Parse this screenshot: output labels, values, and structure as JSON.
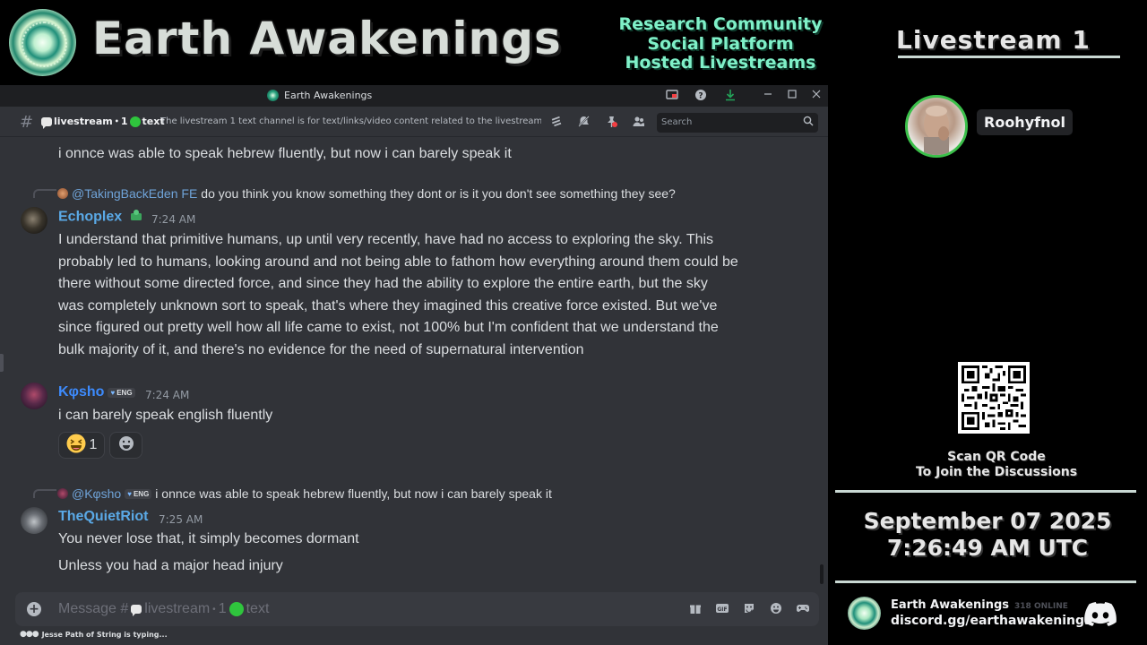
{
  "banner": {
    "title": "Earth Awakenings",
    "taglines": [
      "Research Community",
      "Social Platform",
      "Hosted Livestreams"
    ]
  },
  "window": {
    "app_title": "Earth Awakenings",
    "channel": {
      "name_prefix": "livestream",
      "name_separator": "•",
      "name_number": "1",
      "name_suffix": "text",
      "topic": "The livestream 1 text channel is for text/links/video content related to the livestream 1 voice ..."
    },
    "search_placeholder": "Search"
  },
  "messages": {
    "partial_top_text": "i onnce was able to speak hebrew fluently, but now i can barely speak it",
    "m1": {
      "reply_mention": "@TakingBackEden FE",
      "reply_text": "do you think you know something they dont or is it you don't see something they see?",
      "username": "Echoplex",
      "username_color": "#5aa9e6",
      "timestamp": "7:24 AM",
      "lines": [
        "I understand that primitive humans, up until very recently, have had no access to exploring the sky. This",
        "probably led to humans, looking around and not being able to fathom how everything around them could be",
        "there without some directed force, and since they had the ability to explore the entire earth, but the sky",
        "was completely unknown sort to speak, that's where they imagined this creative force existed. But we've",
        "since figured out pretty well how all life came to exist, not 100% but I'm confident that we understand the",
        "bulk majority of it, and there's no evidence for the need of supernatural intervention"
      ]
    },
    "m2": {
      "username": "Kφsho",
      "username_color": "#3d8bfd",
      "badge": "ENG",
      "timestamp": "7:24 AM",
      "text": "i can barely speak english fluently",
      "reaction_count": "1"
    },
    "m3": {
      "reply_mention": "@Kφsho",
      "reply_badge": "ENG",
      "reply_text": "i onnce was able to speak hebrew fluently, but now i can barely speak it",
      "username": "TheQuietRiot",
      "username_color": "#5aa9e6",
      "timestamp": "7:25 AM",
      "lines": [
        "You never lose that, it simply becomes dormant",
        "Unless you had a major head injury"
      ]
    }
  },
  "composer": {
    "placeholder_prefix": "Message #",
    "typing_text": "Jesse Path of String is typing..."
  },
  "right_panel": {
    "title": "Livestream 1",
    "host_name": "Roohyfnol",
    "qr_caption_line1": "Scan QR Code",
    "qr_caption_line2": "To Join the Discussions",
    "date": "September 07 2025",
    "time": "7:26:49 AM UTC",
    "server_name": "Earth Awakenings",
    "server_online": "318 ONLINE",
    "server_link": "discord.gg/earthawakenings"
  },
  "icons": {
    "titlebar": [
      "screen-share-icon",
      "help-icon",
      "download-icon",
      "minimize-icon",
      "maximize-icon",
      "close-icon"
    ],
    "header": [
      "threads-icon",
      "mute-notifications-icon",
      "pin-icon",
      "members-icon"
    ],
    "composer": [
      "gift-icon",
      "gif-icon",
      "sticker-icon",
      "emoji-icon",
      "activities-icon"
    ]
  },
  "colors": {
    "accent_green": "#7ff0c8",
    "online_green": "#3bbf4a",
    "discord_bg": "#313338"
  }
}
